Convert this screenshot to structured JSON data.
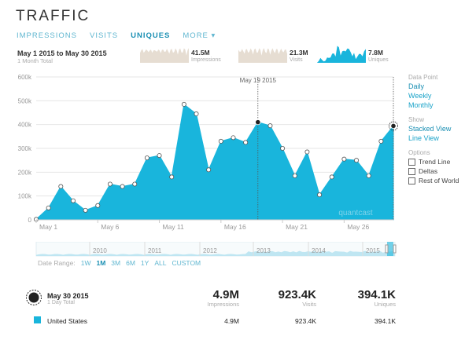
{
  "header": {
    "title": "TRAFFIC"
  },
  "tabs": [
    {
      "label": "IMPRESSIONS",
      "active": false
    },
    {
      "label": "VISITS",
      "active": false
    },
    {
      "label": "UNIQUES",
      "active": true
    },
    {
      "label": "MORE ▾",
      "active": false
    }
  ],
  "range": {
    "label": "May 1 2015 to May 30 2015",
    "sub": "1 Month Total"
  },
  "sparks": [
    {
      "value": "41.5M",
      "label": "Impressions"
    },
    {
      "value": "21.3M",
      "label": "Visits"
    },
    {
      "value": "7.8M",
      "label": "Uniques"
    }
  ],
  "chart_data": {
    "type": "area",
    "x": [
      "May 1",
      "May 2",
      "May 3",
      "May 4",
      "May 5",
      "May 6",
      "May 7",
      "May 8",
      "May 9",
      "May 10",
      "May 11",
      "May 12",
      "May 13",
      "May 14",
      "May 15",
      "May 16",
      "May 17",
      "May 18",
      "May 19",
      "May 20",
      "May 21",
      "May 22",
      "May 23",
      "May 24",
      "May 25",
      "May 26",
      "May 27",
      "May 28",
      "May 29",
      "May 30"
    ],
    "series": [
      {
        "values": [
          2000,
          50000,
          140000,
          80000,
          40000,
          60000,
          150000,
          140000,
          150000,
          260000,
          270000,
          180000,
          485000,
          445000,
          210000,
          330000,
          345000,
          325000,
          410000,
          395000,
          300000,
          185000,
          285000,
          105000,
          180000,
          255000,
          250000,
          185000,
          330000,
          394100
        ],
        "color": "#19b5dc"
      }
    ],
    "x_tick_labels": [
      "May 1",
      "May 6",
      "May 11",
      "May 16",
      "May 21",
      "May 26"
    ],
    "y_tick_labels": [
      "0",
      "100k",
      "200k",
      "300k",
      "400k",
      "500k",
      "600k"
    ],
    "ylim": [
      0,
      600000
    ],
    "annotation": "May 19 2015",
    "watermark": "quantcast",
    "grid": true,
    "navigator_years": [
      "2010",
      "2011",
      "2012",
      "2013",
      "2014",
      "2015"
    ]
  },
  "sidebar": {
    "data_point_heading": "Data Point",
    "data_point_options": [
      {
        "label": "Daily",
        "selected": true
      },
      {
        "label": "Weekly",
        "selected": false
      },
      {
        "label": "Monthly",
        "selected": false
      }
    ],
    "show_heading": "Show",
    "show_options": [
      {
        "label": "Stacked View",
        "selected": true
      },
      {
        "label": "Line View",
        "selected": false
      }
    ],
    "options_heading": "Options",
    "checkboxes": [
      "Trend Line",
      "Deltas",
      "Rest of World"
    ]
  },
  "date_range": {
    "label": "Date Range:",
    "options": [
      {
        "label": "1W",
        "active": false
      },
      {
        "label": "1M",
        "active": true
      },
      {
        "label": "3M",
        "active": false
      },
      {
        "label": "6M",
        "active": false
      },
      {
        "label": "1Y",
        "active": false
      },
      {
        "label": "ALL",
        "active": false
      },
      {
        "label": "CUSTOM",
        "active": false
      }
    ]
  },
  "summary": {
    "date": "May 30 2015",
    "sub": "1 Day Total",
    "impressions": "4.9M",
    "impressions_label": "Impressions",
    "visits": "923.4K",
    "visits_label": "Visits",
    "uniques": "394.1K",
    "uniques_label": "Uniques"
  },
  "row": {
    "country": "United States",
    "color": "#19b5dc",
    "impressions": "4.9M",
    "visits": "923.4K",
    "uniques": "394.1K"
  }
}
